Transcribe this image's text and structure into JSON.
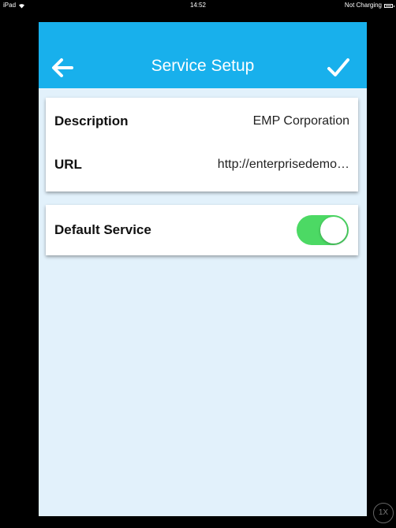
{
  "status_bar": {
    "device": "iPad",
    "time": "14:52",
    "charging": "Not Charging",
    "wifi_icon": "wifi-icon",
    "battery_icon": "battery-icon"
  },
  "nav": {
    "title": "Service Setup",
    "back_icon": "arrow-left-icon",
    "confirm_icon": "checkmark-icon"
  },
  "service": {
    "description_label": "Description",
    "description_value": "EMP Corporation",
    "url_label": "URL",
    "url_value": "http://enterprisedemo…"
  },
  "default_service": {
    "label": "Default Service",
    "enabled": true
  },
  "zoom_badge": "1X",
  "colors": {
    "nav_bg": "#18b0ec",
    "screen_bg": "#e2f1fb",
    "toggle_on": "#4cd964"
  }
}
